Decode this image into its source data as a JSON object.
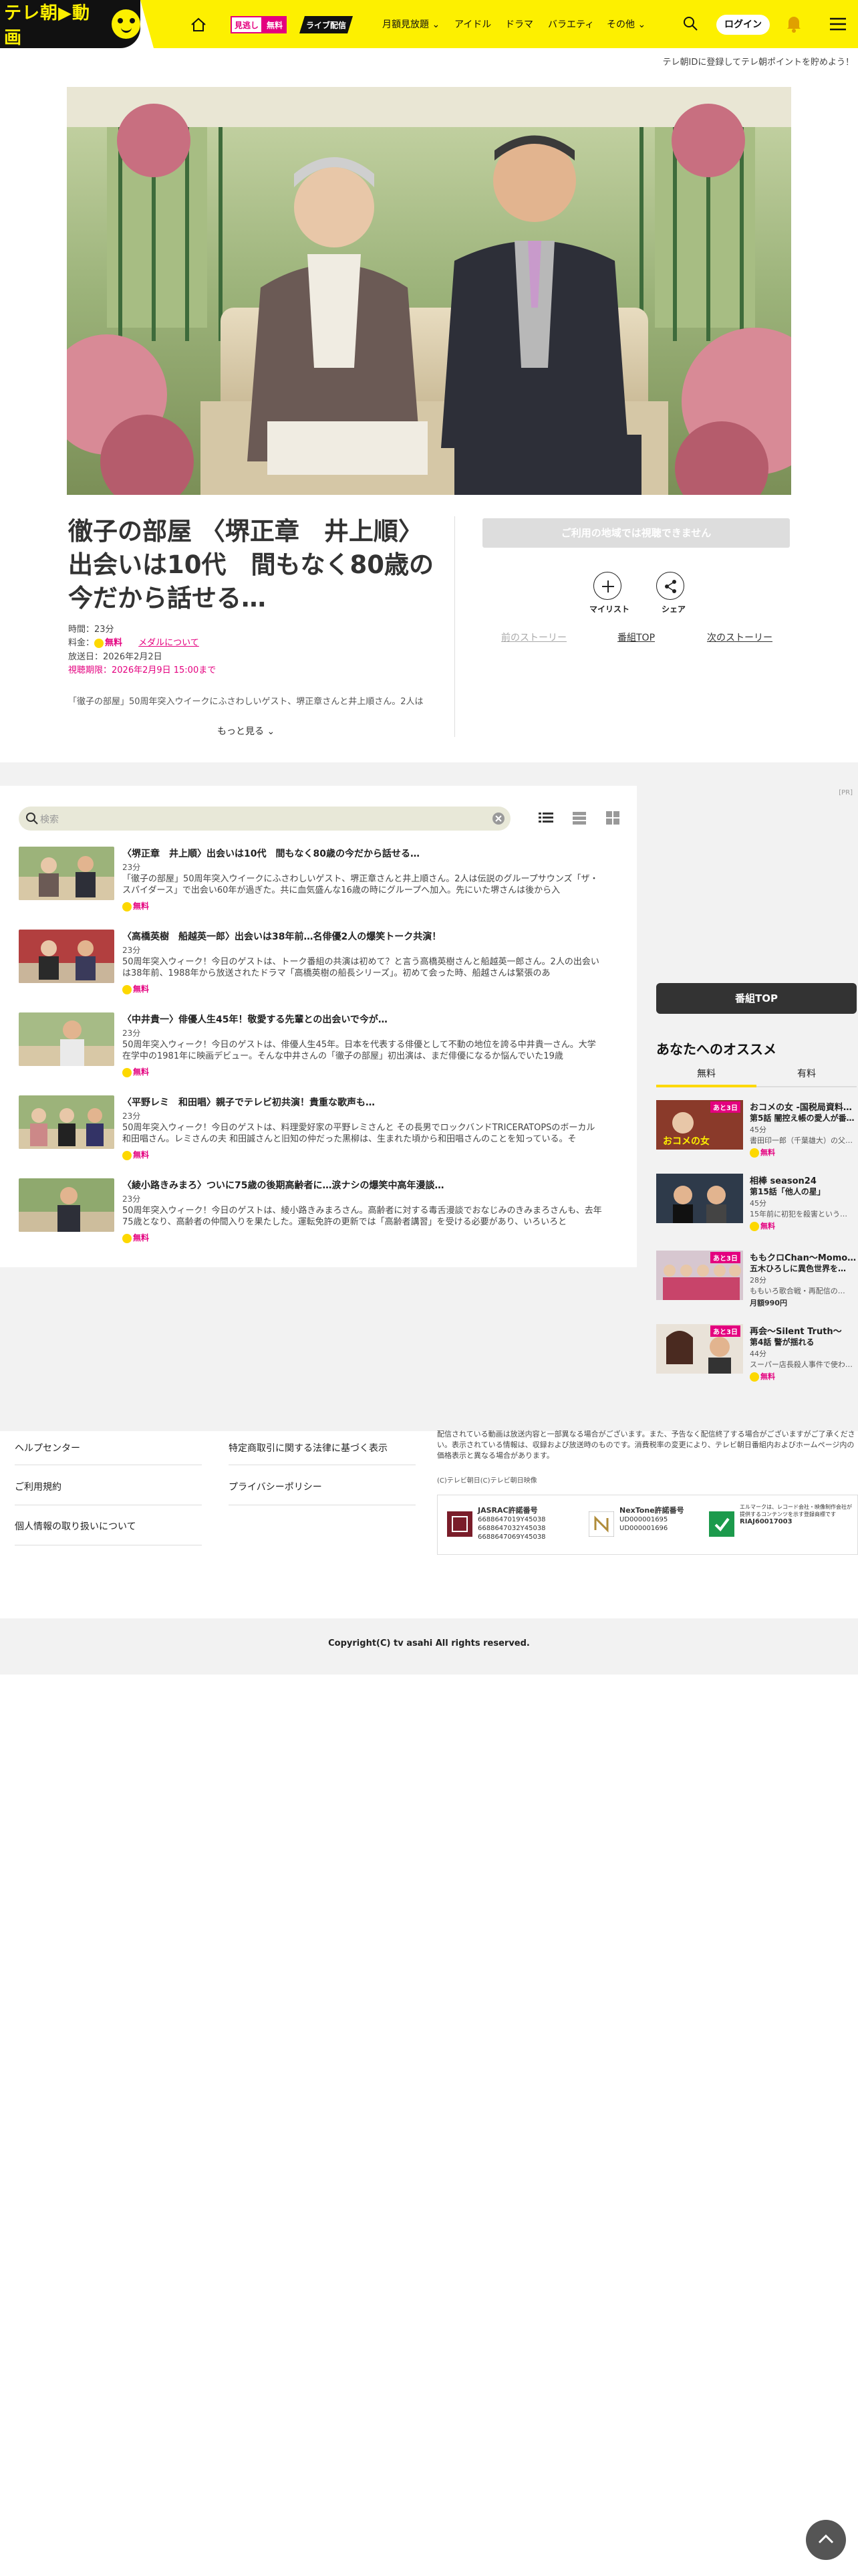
{
  "header": {
    "logo_text": "テレ朝",
    "logo_text2": "動画",
    "mitoshi_a": "見逃し",
    "mitoshi_b": "無料",
    "live": "ライブ配信",
    "nav": [
      "月額見放題",
      "アイドル",
      "ドラマ",
      "バラエティ",
      "その他"
    ],
    "login": "ログイン",
    "sub_notice": "テレ朝IDに登録してテレ朝ポイントを貯めよう！"
  },
  "program": {
    "title": "徹子の部屋 〈堺正章　井上順〉出会いは10代　間もなく80歳の今だから話せる…",
    "time_label": "時間：23分",
    "price_label": "料金：",
    "price_value": "無料",
    "medal_link": "メダルについて",
    "broadcast": "放送日：2026年2月2日",
    "deadline": "視聴期限：2026年2月9日 15:00まで",
    "description": "「徹子の部屋」50周年突入ウイークにふさわしいゲスト、堺正章さんと井上順さん。2人は",
    "more": "もっと見る",
    "cant_watch": "ご利用の地域では視聴できません",
    "mylist": "マイリスト",
    "share": "シェア",
    "prev_story": "前のストーリー",
    "program_top": "番組TOP",
    "next_story": "次のストーリー"
  },
  "episode_list": {
    "search_placeholder": "検索",
    "ad_label": "[PR]",
    "episodes": [
      {
        "title": "〈堺正章　井上順〉出会いは10代　間もなく80歳の今だから話せる…",
        "duration": "23分",
        "desc": "「徹子の部屋」50周年突入ウイークにふさわしいゲスト、堺正章さんと井上順さん。2人は伝説のグループサウンズ「ザ・スパイダース」で出会い60年が過ぎた。共に血気盛んな16歳の時にグループへ加入。先にいた堺さんは後から入",
        "free": "無料"
      },
      {
        "title": "〈高橋英樹　船越英一郎〉出会いは38年前…名俳優2人の爆笑トーク共演！",
        "duration": "23分",
        "desc": "50周年突入ウィーク！今日のゲストは、トーク番組の共演は初めて？と言う高橋英樹さんと船越英一郎さん。2人の出会いは38年前、1988年から放送されたドラマ「高橋英樹の船長シリーズ」。初めて会った時、船越さんは緊張のあ",
        "free": "無料"
      },
      {
        "title": "〈中井貴一〉俳優人生45年！敬愛する先輩との出会いで今が…",
        "duration": "23分",
        "desc": "50周年突入ウィーク！今日のゲストは、俳優人生45年。日本を代表する俳優として不動の地位を誇る中井貴一さん。大学在学中の1981年に映画デビュー。そんな中井さんの「徹子の部屋」初出演は、まだ俳優になるか悩んでいた19歳",
        "free": "無料"
      },
      {
        "title": "〈平野レミ　和田唱〉親子でテレビ初共演！貴重な歌声も…",
        "duration": "23分",
        "desc": "50周年突入ウィーク！今日のゲストは、料理愛好家の平野レミさんと その長男でロックバンドTRICERATOPSのボーカル 和田唱さん。レミさんの夫 和田誠さんと旧知の仲だった黒柳は、生まれた頃から和田唱さんのことを知っている。そ",
        "free": "無料"
      },
      {
        "title": "〈綾小路きみまろ〉ついに75歳の後期高齢者に…涙ナシの爆笑中高年漫談…",
        "duration": "23分",
        "desc": "50周年突入ウィーク！今日のゲストは、綾小路きみまろさん。高齢者に対する毒舌漫談でおなじみのきみまろさんも、去年75歳となり、高齢者の仲間入りを果たした。運転免許の更新では「高齢者講習」を受ける必要があり、いろいろと",
        "free": "無料"
      }
    ]
  },
  "sidebar": {
    "program_top": "番組TOP",
    "reco_title": "あなたへのオススメ",
    "tab_free": "無料",
    "tab_paid": "有料",
    "items": [
      {
        "t1": "おコメの女 -国税局資料…",
        "t2": "第5話 闇控え帳の愛人が番籍…",
        "dur": "45分",
        "desc": "書田印一郎（千葉雄大）の父…",
        "price": "無料",
        "badge": "あと3日"
      },
      {
        "t1": "相棒 season24",
        "t2": "第15話「他人の星」",
        "dur": "45分",
        "desc": "15年前に初犯を殺害という…",
        "price": "無料",
        "badge": ""
      },
      {
        "t1": "ももクロChan〜Momo…",
        "t2": "五木ひろしに異色世界を…",
        "dur": "28分",
        "desc": "ももいろ歌合戦・再配信の…",
        "price": "月額990円",
        "badge": "あと3日"
      },
      {
        "t1": "再会〜Silent Truth〜",
        "t2": "第4話 警が揺れる",
        "dur": "44分",
        "desc": "スーパー店長殺人事件で使わ…",
        "price": "無料",
        "badge": "あと3日"
      }
    ]
  },
  "footer": {
    "links": [
      "ヘルプセンター",
      "ご利用規約",
      "個人情報の取り扱いについて",
      "特定商取引に関する法律に基づく表示",
      "プライバシーポリシー"
    ],
    "note": "配信されている動画は放送内容と一部異なる場合がございます。また、予告なく配信終了する場合がございますがご了承ください。表示されている情報は、収録および放送時のものです。消費税率の変更により、テレビ朝日番組内およびホームページ内の価格表示と異なる場合があります。",
    "copy_note": "(C)テレビ朝日(C)テレビ朝日映像",
    "jasrac_title": "JASRAC許諾番号",
    "jasrac_nums": [
      "6688647019Y45038",
      "6688647032Y45038",
      "6688647069Y45038"
    ],
    "nextone_title": "NexTone許諾番号",
    "nextone_nums": [
      "UD000001695",
      "UD000001696"
    ],
    "lmark_text": "エルマークは、レコード会社・映像制作会社が提供するコンテンツを示す登録商標です",
    "lmark_num": "RIAJ60017003",
    "copyright": "Copyright(C) tv asahi All rights reserved."
  }
}
